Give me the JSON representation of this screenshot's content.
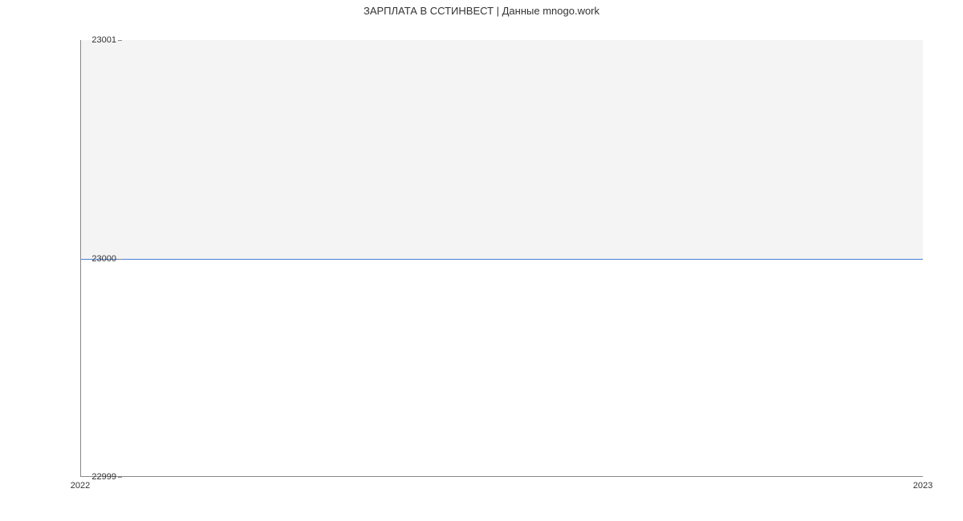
{
  "chart_data": {
    "type": "line",
    "title": "ЗАРПЛАТА В ССТИНВЕСТ | Данные mnogo.work",
    "x": [
      2022,
      2023
    ],
    "values": [
      23000,
      23000
    ],
    "xlabel": "",
    "ylabel": "",
    "ylim": [
      22999,
      23001
    ],
    "y_ticks": [
      22999,
      23000,
      23001
    ],
    "x_ticks": [
      2022,
      2023
    ],
    "colors": {
      "line": "#4a7fd6",
      "upper_bg": "#f4f4f4",
      "lower_bg": "#ffffff"
    }
  }
}
